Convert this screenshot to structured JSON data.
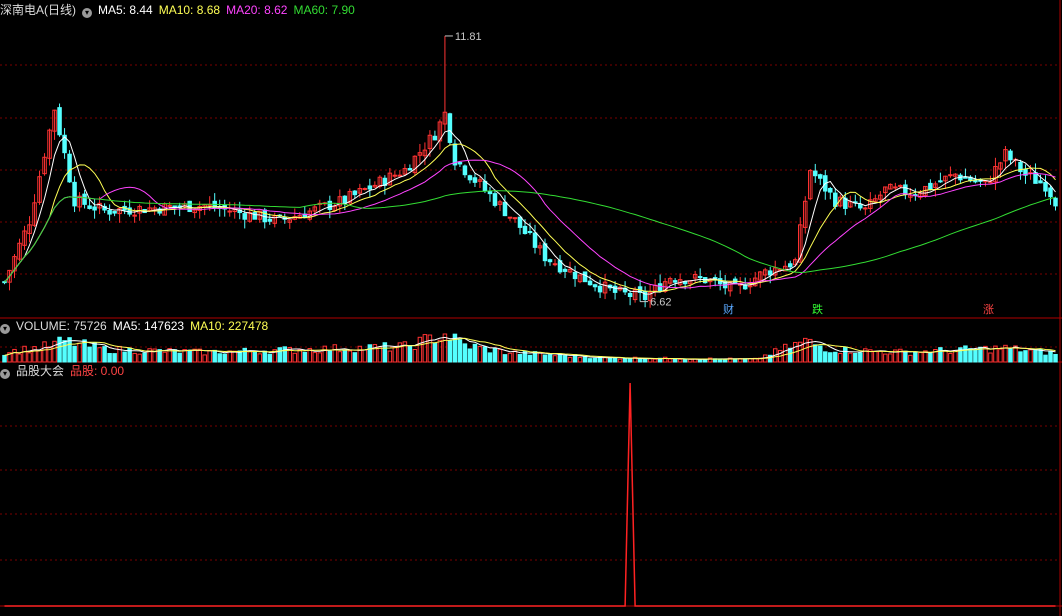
{
  "header": {
    "stock_name": "深南电A(日线)",
    "ma5": "MA5: 8.44",
    "ma10": "MA10: 8.68",
    "ma20": "MA20: 8.62",
    "ma60": "MA60: 7.90"
  },
  "volume_header": {
    "title": "VOLUME: 75726",
    "ma5": "MA5: 147623",
    "ma10": "MA10: 227478"
  },
  "indicator_header": {
    "title": "品股大会",
    "value": "品股: 0.00"
  },
  "badges": [
    {
      "text": "财",
      "color": "#5aa8ff"
    },
    {
      "text": "跌",
      "color": "#33ff33"
    },
    {
      "text": "涨",
      "color": "#ff4444"
    }
  ],
  "annotations": {
    "high_label": "11.81",
    "low_label": "6.62"
  },
  "colors": {
    "up": "#ff3333",
    "down": "#54ffff",
    "ma5": "#ffffff",
    "ma10": "#ffff55",
    "ma20": "#ff44ff",
    "ma60": "#33dd33",
    "grid": "#7a0000",
    "text": "#c8c8c8"
  },
  "chart_data": {
    "type": "candlestick",
    "price_range": [
      6.3,
      12.2
    ],
    "candles": [],
    "volume": [],
    "indicator": [],
    "keyframes": {
      "close": [
        [
          0,
          7.0
        ],
        [
          5,
          8.2
        ],
        [
          10,
          10.4
        ],
        [
          14,
          8.6
        ],
        [
          20,
          8.4
        ],
        [
          40,
          8.5
        ],
        [
          55,
          8.2
        ],
        [
          68,
          8.6
        ],
        [
          80,
          9.2
        ],
        [
          86,
          9.9
        ],
        [
          88,
          10.3
        ],
        [
          90,
          9.4
        ],
        [
          96,
          8.8
        ],
        [
          102,
          8.2
        ],
        [
          108,
          7.5
        ],
        [
          115,
          7.1
        ],
        [
          122,
          6.8
        ],
        [
          128,
          6.7
        ],
        [
          133,
          7.1
        ],
        [
          140,
          7.05
        ],
        [
          146,
          6.85
        ],
        [
          152,
          7.2
        ],
        [
          158,
          7.4
        ],
        [
          161,
          9.2
        ],
        [
          166,
          8.6
        ],
        [
          172,
          8.4
        ],
        [
          176,
          8.8
        ],
        [
          182,
          8.75
        ],
        [
          190,
          9.1
        ],
        [
          196,
          8.9
        ],
        [
          200,
          9.5
        ],
        [
          204,
          9.1
        ],
        [
          208,
          8.9
        ],
        [
          210,
          8.6
        ]
      ],
      "volume": [
        [
          0,
          0.35
        ],
        [
          8,
          0.55
        ],
        [
          12,
          0.75
        ],
        [
          20,
          0.45
        ],
        [
          40,
          0.35
        ],
        [
          60,
          0.45
        ],
        [
          80,
          0.55
        ],
        [
          88,
          1.0
        ],
        [
          92,
          0.6
        ],
        [
          100,
          0.35
        ],
        [
          120,
          0.15
        ],
        [
          150,
          0.1
        ],
        [
          160,
          0.75
        ],
        [
          165,
          0.45
        ],
        [
          180,
          0.35
        ],
        [
          200,
          0.5
        ],
        [
          210,
          0.3
        ]
      ],
      "indicator_spike": {
        "index": 125,
        "value": 1.0
      }
    }
  }
}
